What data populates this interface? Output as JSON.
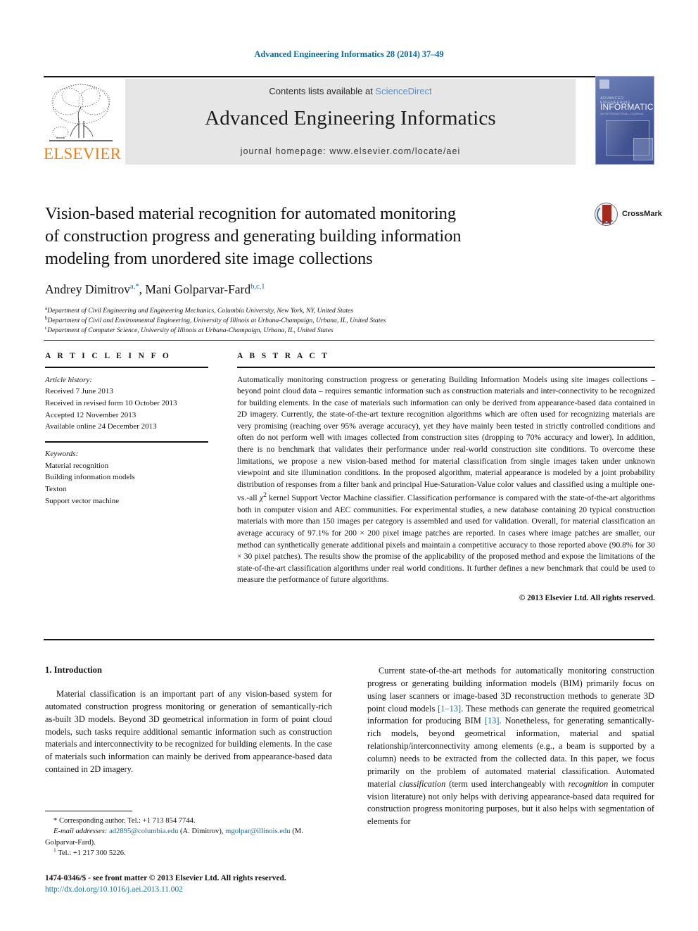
{
  "running_head": "Advanced Engineering Informatics 28 (2014) 37–49",
  "masthead": {
    "contents_prefix": "Contents lists available at",
    "sciencedirect": "ScienceDirect",
    "journal_title": "Advanced Engineering Informatics",
    "homepage": "journal homepage: www.elsevier.com/locate/aei",
    "publisher_wordmark": "ELSEVIER",
    "cover": {
      "kicker": "ADVANCED ENGINEERING",
      "name": "INFORMATICS",
      "sub": "AN INTERNATIONAL JOURNAL"
    }
  },
  "crossmark": {
    "label": "CrossMark"
  },
  "title": {
    "line1": "Vision-based material recognition for automated monitoring",
    "line2": "of construction progress and generating building information",
    "line3": "modeling from unordered site image collections"
  },
  "authors": {
    "author1_name": "Andrey Dimitrov",
    "author1_marks": "a,*",
    "separator": ", ",
    "author2_name": "Mani Golparvar-Fard",
    "author2_marks": "b,c,1"
  },
  "affiliations": [
    {
      "mark": "a",
      "text": "Department of Civil Engineering and Engineering Mechanics, Columbia University, New York, NY, United States"
    },
    {
      "mark": "b",
      "text": "Department of Civil and Environmental Engineering, University of Illinois at Urbana-Champaign, Urbana, IL, United States"
    },
    {
      "mark": "c",
      "text": "Department of Computer Science, University of Illinois at Urbana-Champaign, Urbana, IL, United States"
    }
  ],
  "article_info": {
    "heading": "A R T I C L E    I N F O",
    "history_label": "Article history:",
    "history": [
      "Received 7 June 2013",
      "Received in revised form 10 October 2013",
      "Accepted 12 November 2013",
      "Available online 24 December 2013"
    ],
    "keywords_label": "Keywords:",
    "keywords": [
      "Material recognition",
      "Building information models",
      "Texton",
      "Support vector machine"
    ]
  },
  "abstract": {
    "heading": "A B S T R A C T",
    "text_part1": "Automatically monitoring construction progress or generating Building Information Models using site images collections – beyond point cloud data – requires semantic information such as construction materials and inter-connectivity to be recognized for building elements. In the case of materials such information can only be derived from appearance-based data contained in 2D imagery. Currently, the state-of-the-art texture recognition algorithms which are often used for recognizing materials are very promising (reaching over 95% average accuracy), yet they have mainly been tested in strictly controlled conditions and often do not perform well with images collected from construction sites (dropping to 70% accuracy and lower). In addition, there is no benchmark that validates their performance under real-world construction site conditions. To overcome these limitations, we propose a new vision-based method for material classification from single images taken under unknown viewpoint and site illumination conditions. In the proposed algorithm, material appearance is modeled by a joint probability distribution of responses from a filter bank and principal Hue-Saturation-Value color values and classified using a multiple one-vs.-all ",
    "chi_symbol": "χ",
    "chi_exponent": "2",
    "text_part2": " kernel Support Vector Machine classifier. Classification performance is compared with the state-of-the-art algorithms both in computer vision and AEC communities. For experimental studies, a new database containing 20 typical construction materials with more than 150 images per category is assembled and used for validation. Overall, for material classification an average accuracy of 97.1% for 200 × 200 pixel image patches are reported. In cases where image patches are smaller, our method can synthetically generate additional pixels and maintain a competitive accuracy to those reported above (90.8% for 30 × 30 pixel patches). The results show the promise of the applicability of the proposed method and expose the limitations of the state-of-the-art classification algorithms under real world conditions. It further defines a new benchmark that could be used to measure the performance of future algorithms.",
    "copyright": "© 2013 Elsevier Ltd. All rights reserved."
  },
  "body": {
    "section1_heading": "1. Introduction",
    "left_para": "Material classification is an important part of any vision-based system for automated construction progress monitoring or generation of semantically-rich as-built 3D models. Beyond 3D geometrical information in form of point cloud models, such tasks require additional semantic information such as construction materials and interconnectivity to be recognized for building elements. In the case of materials such information can mainly be derived from appearance-based data contained in 2D imagery.",
    "right_para_a": "Current state-of-the-art methods for automatically monitoring construction progress or generating building information models (BIM) primarily focus on using laser scanners or image-based 3D reconstruction methods to generate 3D point cloud models ",
    "right_ref1": "[1–13]",
    "right_para_b": ". These methods can generate the required geometrical information for producing BIM ",
    "right_ref2": "[13]",
    "right_para_c": ". Nonetheless, for generating semantically-rich models, beyond geometrical information, material and spatial relationship/interconnectivity among elements (e.g., a beam is supported by a column) needs to be extracted from the collected data. In this paper, we focus primarily on the problem of automated material classification. Automated material ",
    "right_italic": "classification",
    "right_para_d": " (term used interchangeably with ",
    "right_italic2": "recognition",
    "right_para_e": " in computer vision literature) not only helps with deriving appearance-based data required for construction progress monitoring purposes, but it also helps with segmentation of elements for"
  },
  "footnotes": {
    "corresponding": "* Corresponding author. Tel.: +1 713 854 7744.",
    "email_label": "E-mail addresses:",
    "email1": "ad2895@columbia.edu",
    "email1_owner": " (A. Dimitrov), ",
    "email2": "mgolpar@illinois.edu",
    "email2_owner": " (M. Golparvar-Fard).",
    "tel_mark": "1",
    "tel": " Tel.: +1 217 300 5226.",
    "issn": "1474-0346/$ - see front matter © 2013 Elsevier Ltd. All rights reserved.",
    "doi": "http://dx.doi.org/10.1016/j.aei.2013.11.002"
  }
}
